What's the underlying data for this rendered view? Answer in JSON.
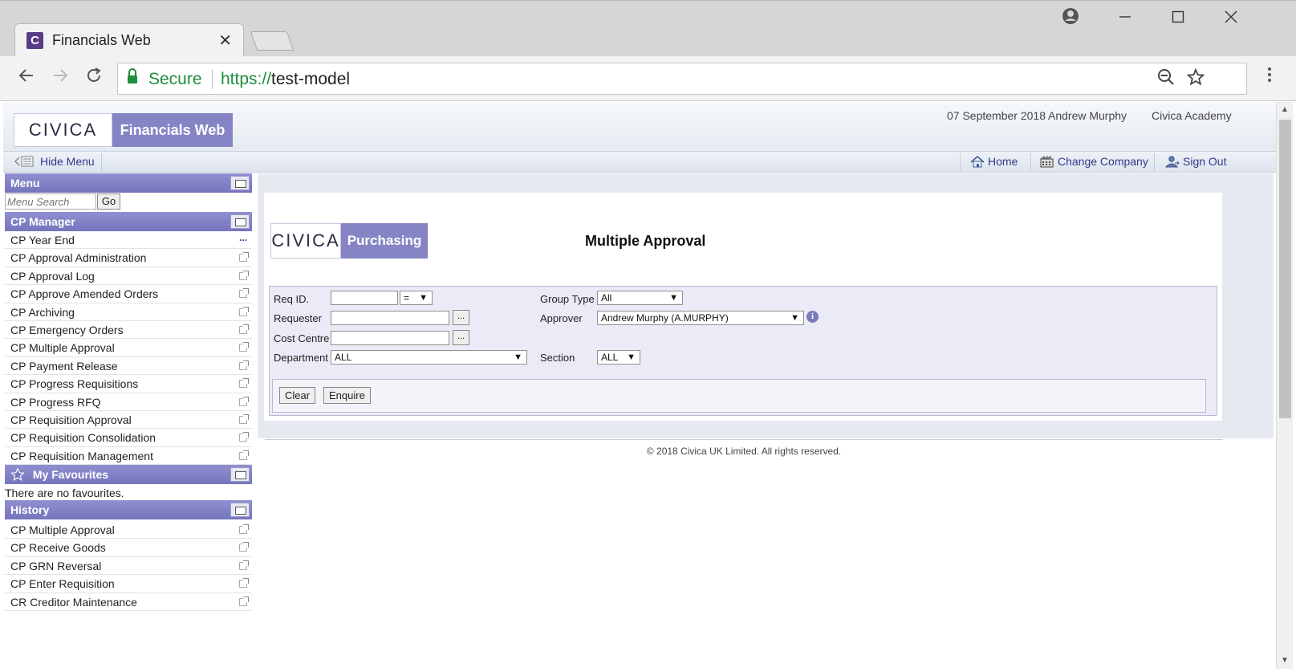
{
  "browser": {
    "tab_title": "Financials Web",
    "tab_favicon": "C",
    "tab_close": "✕",
    "secure_label": "Secure",
    "url_scheme": "https://",
    "url_host": "test-model"
  },
  "header": {
    "logo_text": "CIVICA",
    "product_badge": "Financials Web",
    "date": "07 September 2018",
    "user": "Andrew Murphy",
    "company": "Civica Academy"
  },
  "toolbar": {
    "hide_menu": "Hide Menu",
    "home": "Home",
    "change_company": "Change Company",
    "sign_out": "Sign Out"
  },
  "sidebar": {
    "menu_title": "Menu",
    "search_placeholder": "Menu Search",
    "go_label": "Go",
    "cp_manager_title": "CP Manager",
    "cp_items": [
      "CP Year End",
      "CP Approval Administration",
      "CP Approval Log",
      "CP Approve Amended Orders",
      "CP Archiving",
      "CP Emergency Orders",
      "CP Multiple Approval",
      "CP Payment Release",
      "CP Progress Requisitions",
      "CP Progress RFQ",
      "CP Requisition Approval",
      "CP Requisition Consolidation",
      "CP Requisition Management"
    ],
    "favourites_title": "My Favourites",
    "favourites_empty": "There are no favourites.",
    "history_title": "History",
    "history_items": [
      "CP Multiple Approval",
      "CP Receive Goods",
      "CP GRN Reversal",
      "CP Enter Requisition",
      "CR Creditor Maintenance"
    ]
  },
  "content": {
    "logo_text": "CIVICA",
    "module_badge": "Purchasing",
    "heading": "Multiple Approval",
    "form": {
      "req_id_label": "Req ID.",
      "req_id_value": "",
      "req_id_operator": "=",
      "requester_label": "Requester",
      "requester_value": "",
      "cost_centre_label": "Cost Centre",
      "cost_centre_value": "",
      "department_label": "Department",
      "department_value": "ALL",
      "group_type_label": "Group Type",
      "group_type_value": "All",
      "approver_label": "Approver",
      "approver_value": "Andrew Murphy (A.MURPHY)",
      "section_label": "Section",
      "section_value": "ALL",
      "ellipsis": "...",
      "info_glyph": "i"
    },
    "buttons": {
      "clear": "Clear",
      "enquire": "Enquire"
    },
    "footer": "© 2018 Civica UK Limited. All rights reserved."
  },
  "colors": {
    "accent": "#8585c6",
    "panel_header": "#7e7ec4",
    "link": "#2f3a8a",
    "secure": "#1e8e3e"
  }
}
